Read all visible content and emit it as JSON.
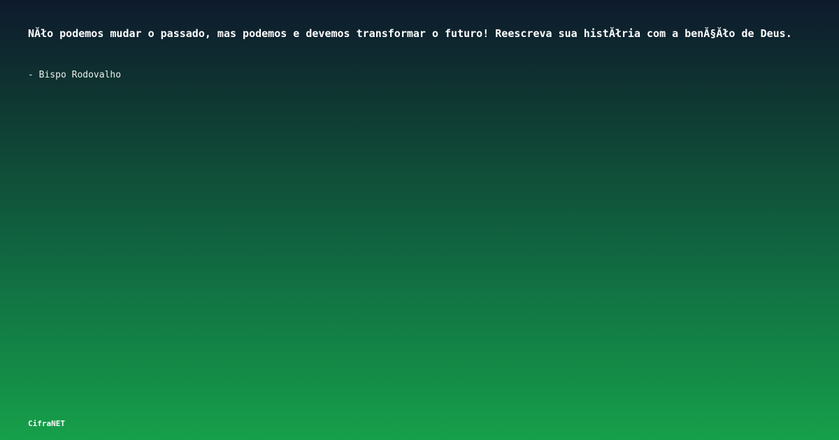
{
  "quote": {
    "text": "NĂło podemos mudar o passado, mas podemos e devemos transformar o futuro! Reescreva sua histĂłria com a benĂ§Ăło de Deus.",
    "author": "- Bispo Rodovalho"
  },
  "brand": {
    "name": "CifraNET"
  },
  "colors": {
    "gradient_top": "#0e1a2d",
    "gradient_bottom": "#16a04a",
    "text": "#ffffff"
  }
}
